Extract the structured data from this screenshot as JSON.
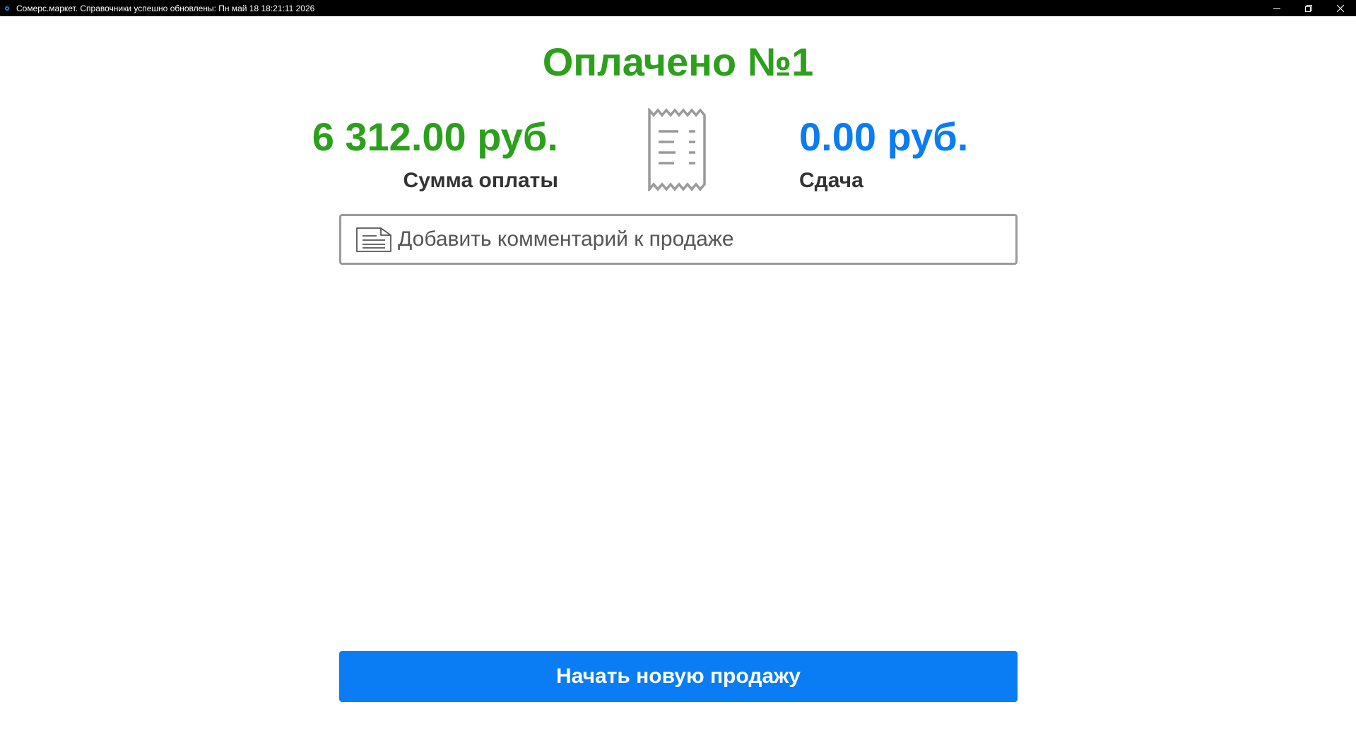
{
  "window": {
    "title": "Сомерс.маркет. Справочники успешно обновлены: Пн май 18 18:21:11 2026",
    "icons": [
      "app-icon",
      "minimize-icon",
      "restore-icon",
      "close-icon"
    ]
  },
  "payment": {
    "heading": "Оплачено №1",
    "amount_paid": "6 312.00 руб.",
    "amount_paid_label": "Сумма оплаты",
    "change": "0.00 руб.",
    "change_label": "Сдача",
    "receipt_icon": "receipt-icon"
  },
  "comment": {
    "placeholder": "Добавить комментарий к продаже",
    "icon": "document-icon"
  },
  "actions": {
    "new_sale": "Начать новую продажу"
  },
  "colors": {
    "success": "#2ca01c",
    "accent": "#0a7cf4",
    "text_dark": "#333333",
    "border": "#9a9a9a"
  }
}
